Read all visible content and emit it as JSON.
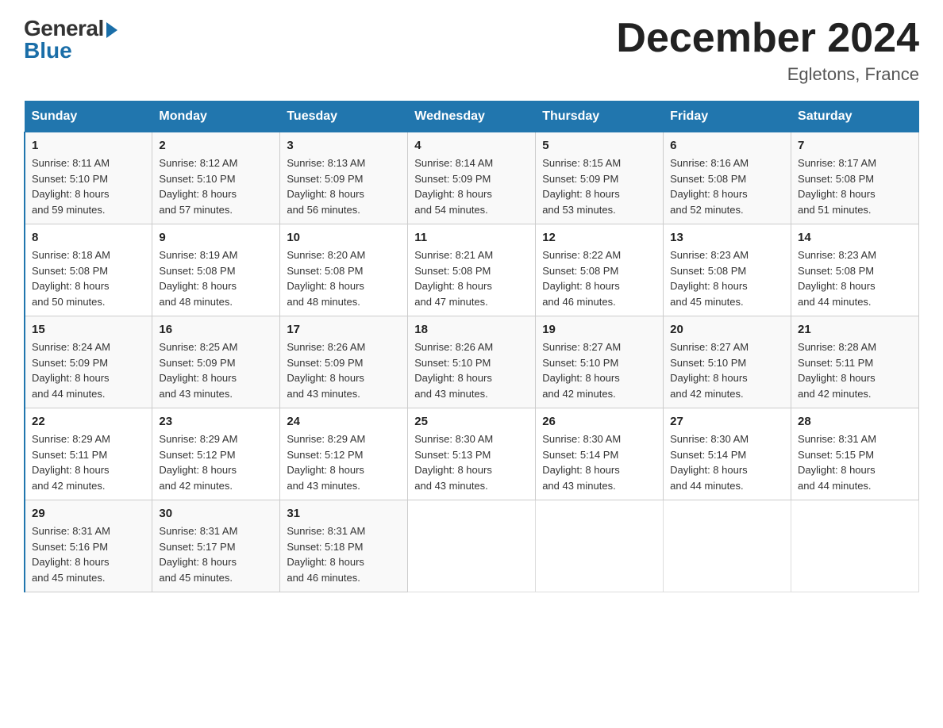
{
  "header": {
    "logo_general": "General",
    "logo_blue": "Blue",
    "month_title": "December 2024",
    "location": "Egletons, France"
  },
  "days_of_week": [
    "Sunday",
    "Monday",
    "Tuesday",
    "Wednesday",
    "Thursday",
    "Friday",
    "Saturday"
  ],
  "weeks": [
    [
      {
        "day": "1",
        "sunrise": "8:11 AM",
        "sunset": "5:10 PM",
        "daylight": "8 hours and 59 minutes."
      },
      {
        "day": "2",
        "sunrise": "8:12 AM",
        "sunset": "5:10 PM",
        "daylight": "8 hours and 57 minutes."
      },
      {
        "day": "3",
        "sunrise": "8:13 AM",
        "sunset": "5:09 PM",
        "daylight": "8 hours and 56 minutes."
      },
      {
        "day": "4",
        "sunrise": "8:14 AM",
        "sunset": "5:09 PM",
        "daylight": "8 hours and 54 minutes."
      },
      {
        "day": "5",
        "sunrise": "8:15 AM",
        "sunset": "5:09 PM",
        "daylight": "8 hours and 53 minutes."
      },
      {
        "day": "6",
        "sunrise": "8:16 AM",
        "sunset": "5:08 PM",
        "daylight": "8 hours and 52 minutes."
      },
      {
        "day": "7",
        "sunrise": "8:17 AM",
        "sunset": "5:08 PM",
        "daylight": "8 hours and 51 minutes."
      }
    ],
    [
      {
        "day": "8",
        "sunrise": "8:18 AM",
        "sunset": "5:08 PM",
        "daylight": "8 hours and 50 minutes."
      },
      {
        "day": "9",
        "sunrise": "8:19 AM",
        "sunset": "5:08 PM",
        "daylight": "8 hours and 48 minutes."
      },
      {
        "day": "10",
        "sunrise": "8:20 AM",
        "sunset": "5:08 PM",
        "daylight": "8 hours and 48 minutes."
      },
      {
        "day": "11",
        "sunrise": "8:21 AM",
        "sunset": "5:08 PM",
        "daylight": "8 hours and 47 minutes."
      },
      {
        "day": "12",
        "sunrise": "8:22 AM",
        "sunset": "5:08 PM",
        "daylight": "8 hours and 46 minutes."
      },
      {
        "day": "13",
        "sunrise": "8:23 AM",
        "sunset": "5:08 PM",
        "daylight": "8 hours and 45 minutes."
      },
      {
        "day": "14",
        "sunrise": "8:23 AM",
        "sunset": "5:08 PM",
        "daylight": "8 hours and 44 minutes."
      }
    ],
    [
      {
        "day": "15",
        "sunrise": "8:24 AM",
        "sunset": "5:09 PM",
        "daylight": "8 hours and 44 minutes."
      },
      {
        "day": "16",
        "sunrise": "8:25 AM",
        "sunset": "5:09 PM",
        "daylight": "8 hours and 43 minutes."
      },
      {
        "day": "17",
        "sunrise": "8:26 AM",
        "sunset": "5:09 PM",
        "daylight": "8 hours and 43 minutes."
      },
      {
        "day": "18",
        "sunrise": "8:26 AM",
        "sunset": "5:10 PM",
        "daylight": "8 hours and 43 minutes."
      },
      {
        "day": "19",
        "sunrise": "8:27 AM",
        "sunset": "5:10 PM",
        "daylight": "8 hours and 42 minutes."
      },
      {
        "day": "20",
        "sunrise": "8:27 AM",
        "sunset": "5:10 PM",
        "daylight": "8 hours and 42 minutes."
      },
      {
        "day": "21",
        "sunrise": "8:28 AM",
        "sunset": "5:11 PM",
        "daylight": "8 hours and 42 minutes."
      }
    ],
    [
      {
        "day": "22",
        "sunrise": "8:29 AM",
        "sunset": "5:11 PM",
        "daylight": "8 hours and 42 minutes."
      },
      {
        "day": "23",
        "sunrise": "8:29 AM",
        "sunset": "5:12 PM",
        "daylight": "8 hours and 42 minutes."
      },
      {
        "day": "24",
        "sunrise": "8:29 AM",
        "sunset": "5:12 PM",
        "daylight": "8 hours and 43 minutes."
      },
      {
        "day": "25",
        "sunrise": "8:30 AM",
        "sunset": "5:13 PM",
        "daylight": "8 hours and 43 minutes."
      },
      {
        "day": "26",
        "sunrise": "8:30 AM",
        "sunset": "5:14 PM",
        "daylight": "8 hours and 43 minutes."
      },
      {
        "day": "27",
        "sunrise": "8:30 AM",
        "sunset": "5:14 PM",
        "daylight": "8 hours and 44 minutes."
      },
      {
        "day": "28",
        "sunrise": "8:31 AM",
        "sunset": "5:15 PM",
        "daylight": "8 hours and 44 minutes."
      }
    ],
    [
      {
        "day": "29",
        "sunrise": "8:31 AM",
        "sunset": "5:16 PM",
        "daylight": "8 hours and 45 minutes."
      },
      {
        "day": "30",
        "sunrise": "8:31 AM",
        "sunset": "5:17 PM",
        "daylight": "8 hours and 45 minutes."
      },
      {
        "day": "31",
        "sunrise": "8:31 AM",
        "sunset": "5:18 PM",
        "daylight": "8 hours and 46 minutes."
      },
      null,
      null,
      null,
      null
    ]
  ],
  "labels": {
    "sunrise": "Sunrise:",
    "sunset": "Sunset:",
    "daylight": "Daylight:"
  }
}
